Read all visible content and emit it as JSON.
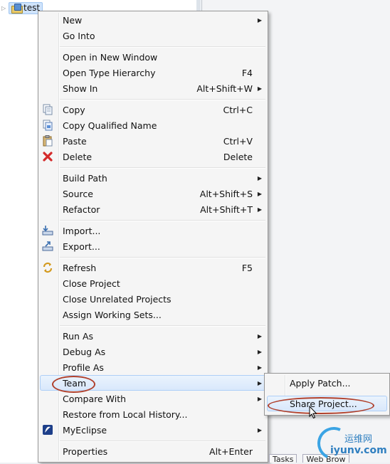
{
  "explorer": {
    "project_label": "test"
  },
  "menu": {
    "items": [
      {
        "label": "New",
        "shortcut": "",
        "submenu": true
      },
      {
        "label": "Go Into",
        "shortcut": "",
        "submenu": false
      },
      {
        "label": "Open in New Window",
        "shortcut": "",
        "submenu": false
      },
      {
        "label": "Open Type Hierarchy",
        "shortcut": "F4",
        "submenu": false
      },
      {
        "label": "Show In",
        "shortcut": "Alt+Shift+W",
        "submenu": true
      },
      {
        "label": "Copy",
        "shortcut": "Ctrl+C",
        "icon": "copy-icon"
      },
      {
        "label": "Copy Qualified Name",
        "shortcut": "",
        "icon": "copy-qualified-name-icon"
      },
      {
        "label": "Paste",
        "shortcut": "Ctrl+V",
        "icon": "paste-icon"
      },
      {
        "label": "Delete",
        "shortcut": "Delete",
        "icon": "delete-icon"
      },
      {
        "label": "Build Path",
        "shortcut": "",
        "submenu": true
      },
      {
        "label": "Source",
        "shortcut": "Alt+Shift+S",
        "submenu": true
      },
      {
        "label": "Refactor",
        "shortcut": "Alt+Shift+T",
        "submenu": true
      },
      {
        "label": "Import...",
        "shortcut": "",
        "icon": "import-icon"
      },
      {
        "label": "Export...",
        "shortcut": "",
        "icon": "export-icon"
      },
      {
        "label": "Refresh",
        "shortcut": "F5",
        "icon": "refresh-icon"
      },
      {
        "label": "Close Project",
        "shortcut": ""
      },
      {
        "label": "Close Unrelated Projects",
        "shortcut": ""
      },
      {
        "label": "Assign Working Sets...",
        "shortcut": ""
      },
      {
        "label": "Run As",
        "shortcut": "",
        "submenu": true
      },
      {
        "label": "Debug As",
        "shortcut": "",
        "submenu": true
      },
      {
        "label": "Profile As",
        "shortcut": "",
        "submenu": true
      },
      {
        "label": "Team",
        "shortcut": "",
        "submenu": true,
        "highlighted": true
      },
      {
        "label": "Compare With",
        "shortcut": "",
        "submenu": true
      },
      {
        "label": "Restore from Local History...",
        "shortcut": ""
      },
      {
        "label": "MyEclipse",
        "shortcut": "",
        "submenu": true,
        "icon": "myeclipse-icon"
      },
      {
        "label": "Properties",
        "shortcut": "Alt+Enter"
      }
    ]
  },
  "team_submenu": {
    "items": [
      {
        "label": "Apply Patch..."
      },
      {
        "label": "Share Project...",
        "highlighted": true
      }
    ]
  },
  "bottom_tabs": [
    "Tasks",
    "Web Brow"
  ],
  "watermark": {
    "line1": "运维网",
    "line2": "iyunv.com"
  },
  "colors": {
    "highlight_border": "#aecff7",
    "annotation": "#b0402c",
    "delete_red": "#d42a2a"
  }
}
